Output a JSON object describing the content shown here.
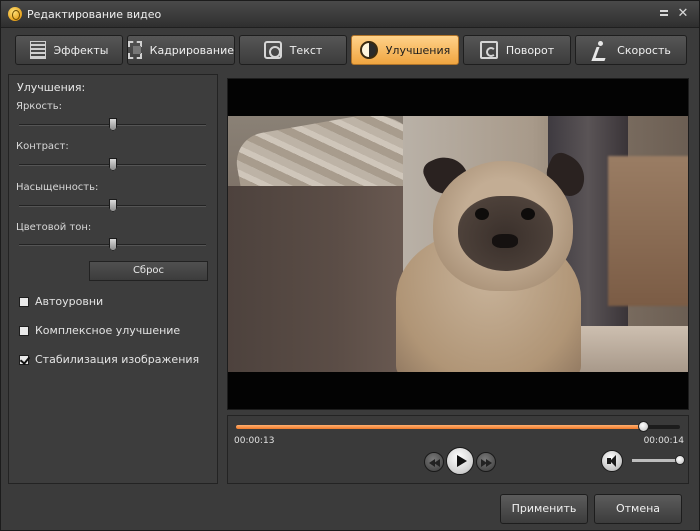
{
  "window": {
    "title": "Редактирование видео"
  },
  "tabs": [
    {
      "label": "Эффекты",
      "icon": "effects-icon",
      "active": false
    },
    {
      "label": "Кадрирование",
      "icon": "crop-icon",
      "active": false
    },
    {
      "label": "Текст",
      "icon": "text-icon",
      "active": false
    },
    {
      "label": "Улучшения",
      "icon": "enhance-icon",
      "active": true
    },
    {
      "label": "Поворот",
      "icon": "rotate-icon",
      "active": false
    },
    {
      "label": "Скорость",
      "icon": "speed-icon",
      "active": false
    }
  ],
  "enhancements": {
    "title": "Улучшения:",
    "sliders": [
      {
        "label": "Яркость:",
        "value": 0.5
      },
      {
        "label": "Контраст:",
        "value": 0.5
      },
      {
        "label": "Насыщенность:",
        "value": 0.5
      },
      {
        "label": "Цветовой тон:",
        "value": 0.5
      }
    ],
    "reset_label": "Сброс",
    "checkboxes": [
      {
        "label": "Автоуровни",
        "checked": false
      },
      {
        "label": "Комплексное улучшение",
        "checked": false
      },
      {
        "label": "Стабилизация изображения",
        "checked": true
      }
    ]
  },
  "player": {
    "current_time": "00:00:13",
    "total_time": "00:00:14",
    "progress": 0.92,
    "volume": 0.95
  },
  "footer": {
    "apply_label": "Применить",
    "cancel_label": "Отмена"
  },
  "colors": {
    "accent": "#f0a540",
    "seek_fill": "#f07a2a",
    "background": "#3b3b3b"
  }
}
